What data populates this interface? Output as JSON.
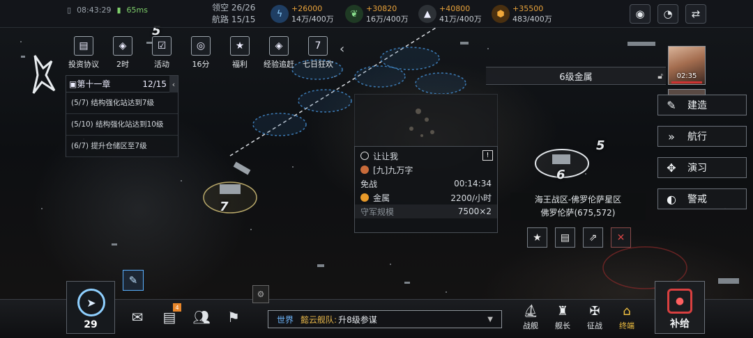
{
  "status": {
    "time": "08:43:29",
    "signal": "65ms"
  },
  "airspace": {
    "label": "领空",
    "value": "26/26"
  },
  "routes": {
    "label": "航路",
    "value": "15/15"
  },
  "resources": [
    {
      "icon": "energy-icon",
      "plus": "+26000",
      "amount": "14万/400万",
      "color": "#3b8fe0"
    },
    {
      "icon": "leaf-icon",
      "plus": "+30820",
      "amount": "16万/400万",
      "color": "#4caf50"
    },
    {
      "icon": "crystal-icon",
      "plus": "+40800",
      "amount": "41万/400万",
      "color": "#cfd3d7"
    },
    {
      "icon": "metal-icon",
      "plus": "+35500",
      "amount": "483/400万",
      "color": "#e89a2a"
    }
  ],
  "activities": [
    {
      "icon": "document-icon",
      "glyph": "▤",
      "label": "投资协议"
    },
    {
      "icon": "box-icon",
      "glyph": "◈",
      "label": "2时"
    },
    {
      "icon": "calendar-check-icon",
      "glyph": "☑",
      "label": "活动"
    },
    {
      "icon": "target-icon",
      "glyph": "◎",
      "label": "16分"
    },
    {
      "icon": "star-badge-icon",
      "glyph": "★",
      "label": "福利"
    },
    {
      "icon": "box-icon",
      "glyph": "◈",
      "label": "经验追赶"
    },
    {
      "icon": "calendar-7-icon",
      "glyph": "7",
      "label": "七日狂欢"
    }
  ],
  "quest": {
    "title": "第十一章",
    "progress": "12/15",
    "items": [
      "(5/7) 结构强化站达到7级",
      "(5/10) 结构强化站达到10级",
      "(6/7) 提升仓储区至7级"
    ]
  },
  "target": {
    "player": "让让我",
    "alliance": "[九]九万字",
    "status_label": "免战",
    "status_timer": "00:14:34",
    "resource_name": "金属",
    "resource_rate": "2200/小时",
    "garrison_label": "守军规模",
    "garrison_value": "7500×2"
  },
  "metal_banner": "6级金属",
  "avatar_time": "02:35",
  "side_buttons": [
    {
      "icon": "wrench-icon",
      "glyph": "✎",
      "label": "建造"
    },
    {
      "icon": "chevrons-right-icon",
      "glyph": "»",
      "label": "航行"
    },
    {
      "icon": "drill-icon",
      "glyph": "✥",
      "label": "演习"
    },
    {
      "icon": "shield-alert-icon",
      "glyph": "◐",
      "label": "警戒"
    }
  ],
  "location": {
    "line1": "海王战区-佛罗伦萨星区",
    "line2": "佛罗伦萨(675,572)"
  },
  "map_numbers": {
    "a": "5",
    "b": "5",
    "c": "6",
    "d": "7"
  },
  "player_level": "29",
  "mail_badge": "4",
  "chat": {
    "channel": "世界",
    "sender": "懿云舰队:",
    "message": "升8级参谋"
  },
  "bottom_nav": [
    {
      "icon": "warship-icon",
      "glyph": "⛵",
      "label": "战舰"
    },
    {
      "icon": "captain-icon",
      "glyph": "♜",
      "label": "舰长"
    },
    {
      "icon": "conquest-icon",
      "glyph": "✠",
      "label": "征战"
    },
    {
      "icon": "terminal-icon",
      "glyph": "⌂",
      "label": "终端",
      "active": true
    }
  ],
  "supply_label": "补给",
  "colors": {
    "accent": "#e8a23a",
    "chat_channel": "#6fb8ff",
    "alert": "#d94040"
  }
}
